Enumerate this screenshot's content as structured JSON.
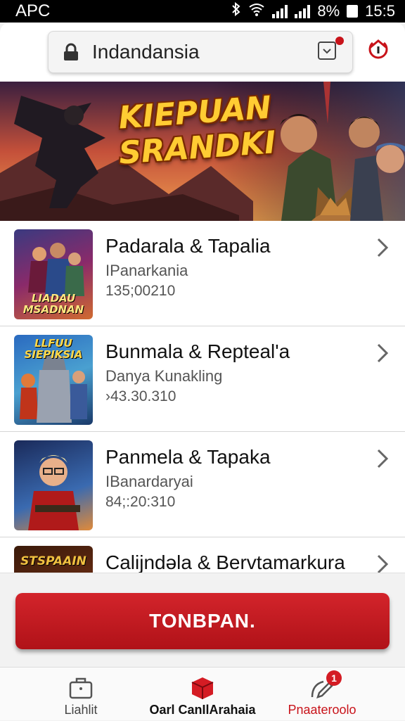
{
  "status_bar": {
    "carrier": "APC",
    "battery_text": "8%",
    "time": "15:5"
  },
  "browser": {
    "url": "Indandansia",
    "icons": [
      "lock-icon",
      "download-icon",
      "power-icon"
    ],
    "accent_color": "#c8131a"
  },
  "banner": {
    "title": "KIEPUAN SRANDKI"
  },
  "list": {
    "items": [
      {
        "title": "Padarala & Tapalia",
        "subtitle": "IPanarkania",
        "number": "135;00210",
        "thumb_caption": "LIADAU MSADNAN"
      },
      {
        "title": "Bunmala & Repteal'a",
        "subtitle": "Danya Kunakling",
        "number": "›43.30.310",
        "thumb_caption": "LLFUU SIEPIKSIA"
      },
      {
        "title": "Panmela & Tapaka",
        "subtitle": "IBanardaryai",
        "number": "84;:20:310",
        "thumb_caption": ""
      },
      {
        "title": "Calijndəla & Bervtamarkura",
        "subtitle": "",
        "number": "",
        "thumb_caption": "STSPAAIN"
      }
    ]
  },
  "cta": {
    "label": "TONBPAN."
  },
  "bottom_nav": {
    "items": [
      {
        "label": "Liahlit",
        "icon": "briefcase-icon",
        "color": "#444444"
      },
      {
        "label": "Oarl CanIlArahaia",
        "icon": "red-box-icon",
        "color": "#111111"
      },
      {
        "label": "Pnaateroolo",
        "icon": "edit-icon",
        "color": "#c8131a",
        "badge": "1"
      }
    ]
  }
}
